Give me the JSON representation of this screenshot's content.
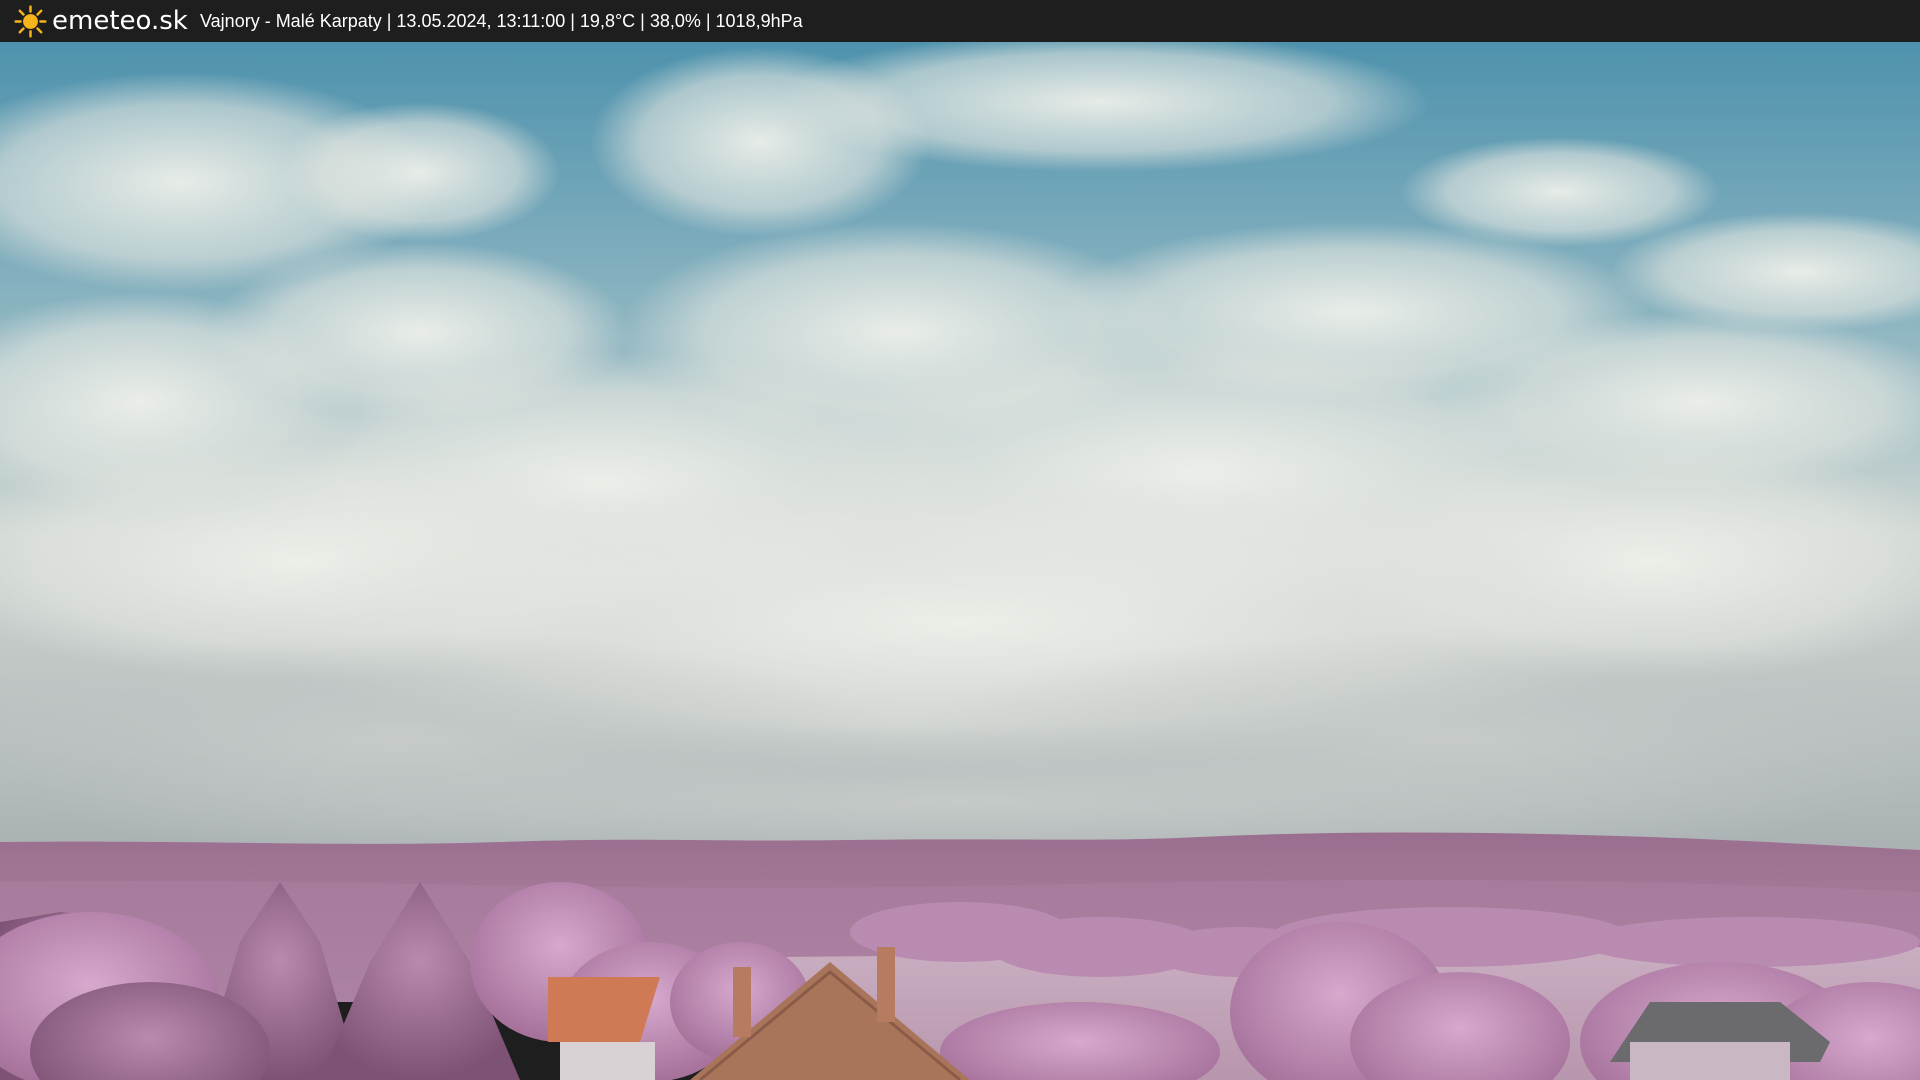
{
  "header": {
    "brand": "emeteo.sk",
    "logo_icon": "sun-icon",
    "caption": "Vajnory - Malé Karpaty | 13.05.2024, 13:11:00 | 19,8°C | 38,0% | 1018,9hPa"
  },
  "colors": {
    "bar_background": "#1e1e1e",
    "sun_yellow": "#f5b41a",
    "sky_blue": "#4f93ae",
    "cloud_white": "#e6e9e2",
    "vegetation_pink": "#b07aa5",
    "roof_orange": "#cf7a55"
  }
}
